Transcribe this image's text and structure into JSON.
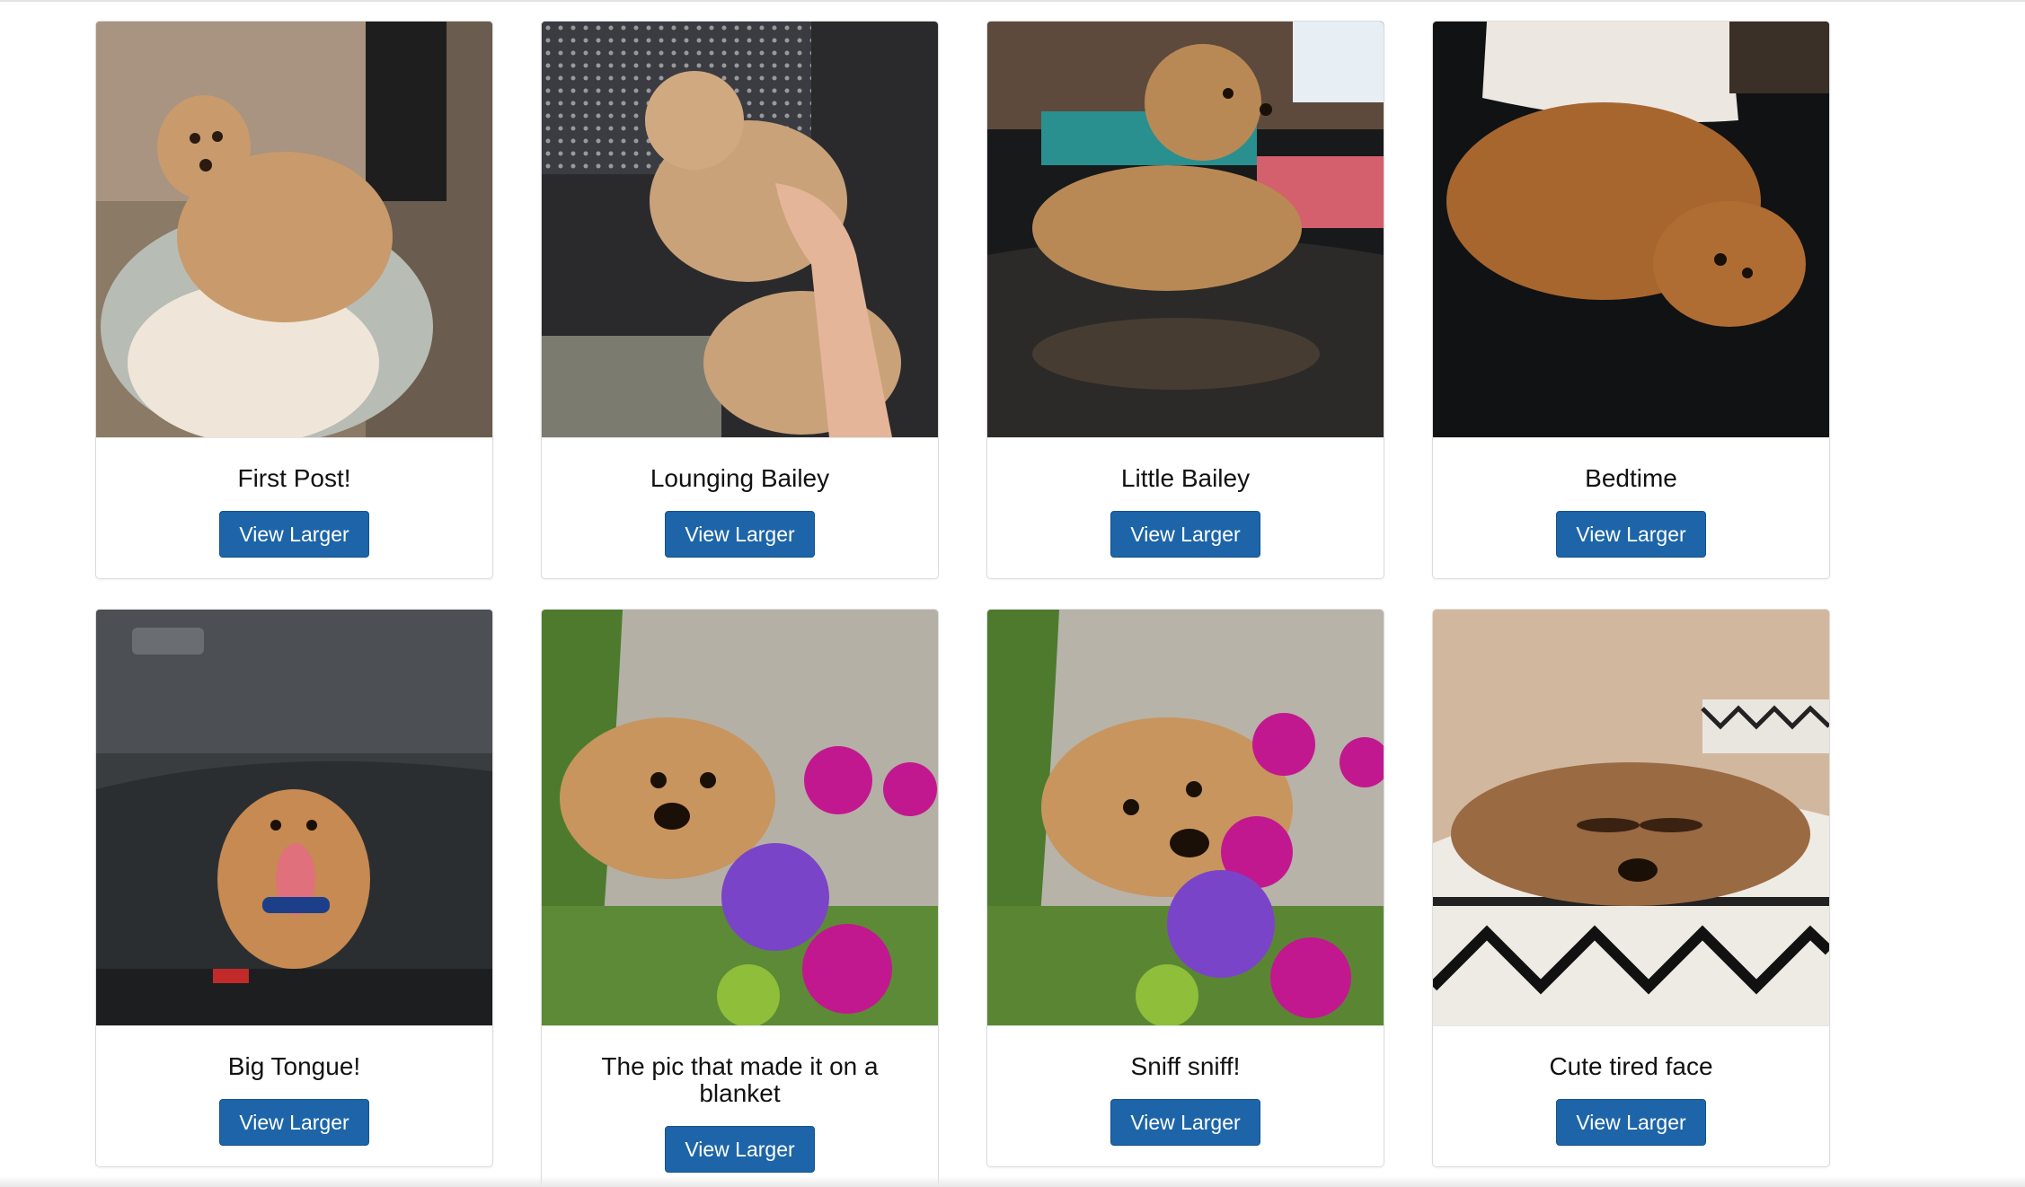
{
  "gallery": {
    "cards": [
      {
        "caption": "First Post!",
        "button": "View Larger",
        "photo": "dog-in-bed-photo"
      },
      {
        "caption": "Lounging Bailey",
        "button": "View Larger",
        "photo": "dog-on-lap-photo"
      },
      {
        "caption": "Little Bailey",
        "button": "View Larger",
        "photo": "dog-on-couch-photo"
      },
      {
        "caption": "Bedtime",
        "button": "View Larger",
        "photo": "dog-sleeping-photo"
      },
      {
        "caption": "Big Tongue!",
        "button": "View Larger",
        "photo": "dog-in-car-photo"
      },
      {
        "caption": "The pic that made it on a blanket",
        "button": "View Larger",
        "photo": "dog-with-flowers-photo"
      },
      {
        "caption": "Sniff sniff!",
        "button": "View Larger",
        "photo": "dog-sniffing-flowers-photo"
      },
      {
        "caption": "Cute tired face",
        "button": "View Larger",
        "photo": "dog-tired-face-photo"
      }
    ]
  },
  "colors": {
    "button_bg": "#1d65a8",
    "button_text": "#ffffff",
    "caption_text": "#111111"
  }
}
